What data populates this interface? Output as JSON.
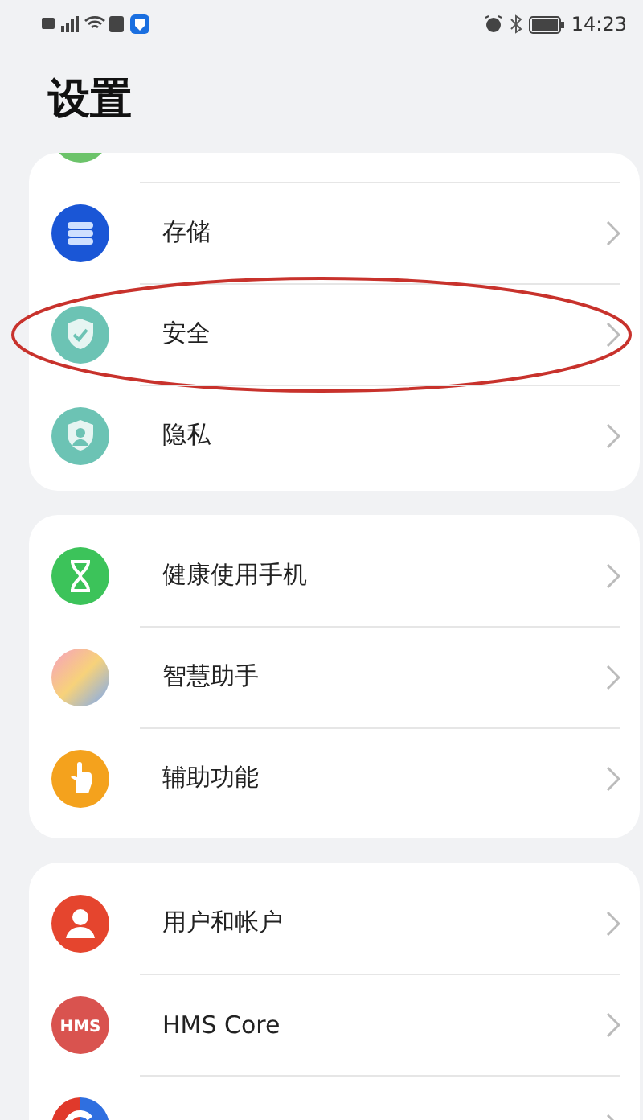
{
  "status_bar": {
    "time": "14:23"
  },
  "title": "设置",
  "groups": [
    {
      "partial_top": true,
      "items": [
        {
          "kind": "storage",
          "label": "存储"
        },
        {
          "kind": "security",
          "label": "安全",
          "highlighted": true
        },
        {
          "kind": "privacy",
          "label": "隐私"
        }
      ]
    },
    {
      "partial_top": false,
      "items": [
        {
          "kind": "health",
          "label": "健康使用手机"
        },
        {
          "kind": "assistant",
          "label": "智慧助手"
        },
        {
          "kind": "accessibility",
          "label": "辅助功能"
        }
      ]
    },
    {
      "partial_top": false,
      "items": [
        {
          "kind": "user",
          "label": "用户和帐户"
        },
        {
          "kind": "hms",
          "icon_text": "HMS",
          "label": "HMS Core"
        },
        {
          "kind": "google"
        }
      ]
    }
  ]
}
